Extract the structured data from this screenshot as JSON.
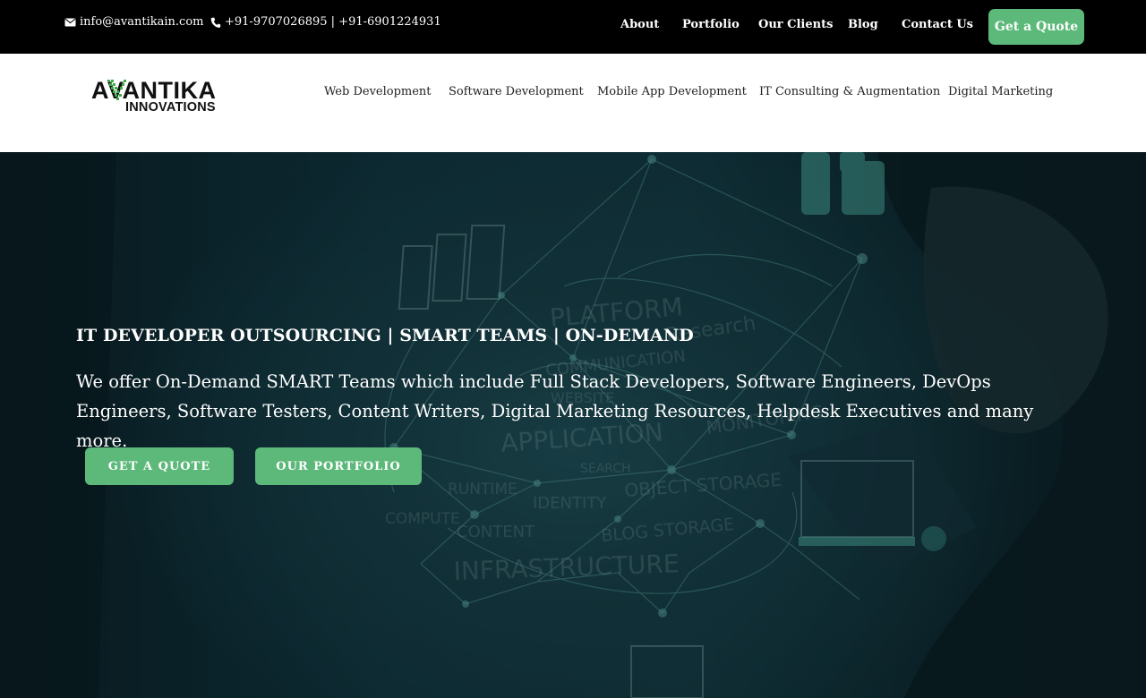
{
  "topbar": {
    "email": "info@avantikain.com",
    "phone": "+91-9707026895 | +91-6901224931",
    "nav": [
      {
        "label": "About"
      },
      {
        "label": "Portfolio"
      },
      {
        "label": "Our Clients"
      },
      {
        "label": "Blog"
      },
      {
        "label": "Contact Us"
      }
    ],
    "quote_button": "Get a Quote"
  },
  "header": {
    "logo": {
      "line1": "AVANTIKA",
      "line2": "INNOVATIONS",
      "accent_color": "#3cab48"
    },
    "nav": [
      {
        "label": "Web Development"
      },
      {
        "label": "Software Development"
      },
      {
        "label": "Mobile App Development"
      },
      {
        "label": "IT Consulting & Augmentation"
      },
      {
        "label": "Digital Marketing"
      }
    ]
  },
  "hero": {
    "heading": "IT DEVELOPER OUTSOURCING | SMART TEAMS | ON-DEMAND",
    "text": "We offer On-Demand SMART Teams which include Full Stack Developers, Software Engineers, DevOps Engineers, Software Testers, Content Writers, Digital Marketing Resources, Helpdesk Executives and many more.",
    "buttons": {
      "quote": "GET A QUOTE",
      "portfolio": "OUR PORTFOLIO"
    },
    "art_words": [
      "PLATFORM",
      "Research",
      "COMMUNICATION",
      "APPLICATION",
      "MONITORING",
      "OBJECT STORAGE",
      "IDENTITY",
      "BLOG STORAGE",
      "CONTENT",
      "RUNTIME",
      "COMPUTE",
      "INFRASTRUCTURE",
      "SEARCH",
      "WEBSITE"
    ]
  },
  "colors": {
    "accent": "#5cb97a",
    "topbar_bg": "#000000",
    "header_bg": "#ffffff"
  },
  "icons": {
    "email": "envelope-icon",
    "phone": "phone-icon"
  }
}
